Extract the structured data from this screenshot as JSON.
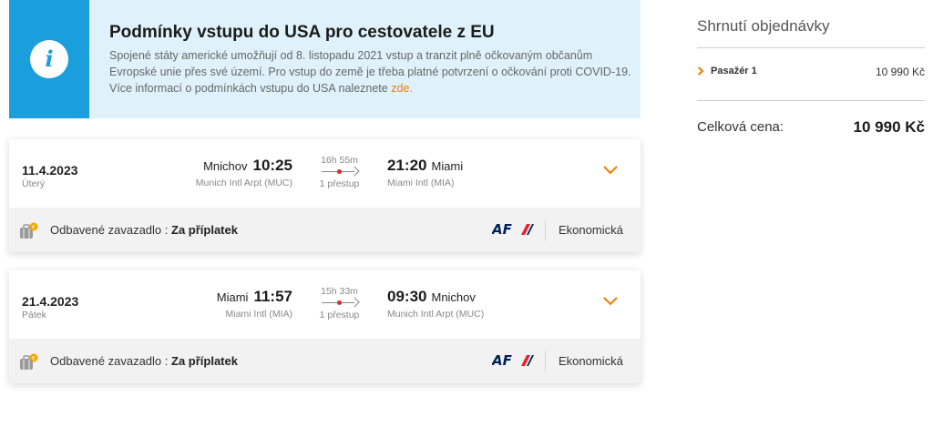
{
  "banner": {
    "title": "Podmínky vstupu do USA pro cestovatele z EU",
    "text_line1": "Spojené státy americké umožňují od 8. listopadu 2021 vstup a tranzit plně očkovaným občanům",
    "text_line2": "Evropské unie přes své území. Pro vstup do země je třeba platné potvrzení o očkování proti COVID-19.",
    "text_line3": "Více informací o podmínkách vstupu do USA naleznete",
    "link": "zde.",
    "icon": "info-icon",
    "accent_color": "#1a9fdc"
  },
  "flights": [
    {
      "date": "11.4.2023",
      "weekday": "Úterý",
      "dep_city": "Mnichov",
      "dep_time": "10:25",
      "dep_airport": "Munich Intl Arpt (MUC)",
      "duration": "16h 55m",
      "stops": "1 přestup",
      "arr_time": "21:20",
      "arr_city": "Miami",
      "arr_airport": "Miami Intl (MIA)",
      "baggage_label": "Odbavené zavazadlo :",
      "baggage_value": "Za příplatek",
      "airline": "AF",
      "cabin": "Ekonomická"
    },
    {
      "date": "21.4.2023",
      "weekday": "Pátek",
      "dep_city": "Miami",
      "dep_time": "11:57",
      "dep_airport": "Miami Intl (MIA)",
      "duration": "15h 33m",
      "stops": "1 přestup",
      "arr_time": "09:30",
      "arr_city": "Mnichov",
      "arr_airport": "Munich Intl Arpt (MUC)",
      "baggage_label": "Odbavené zavazadlo :",
      "baggage_value": "Za příplatek",
      "airline": "AF",
      "cabin": "Ekonomická"
    }
  ],
  "summary": {
    "title": "Shrnutí objednávky",
    "passenger_label": "Pasažér 1",
    "passenger_price": "10 990 Kč",
    "total_label": "Celková cena:",
    "total_value": "10 990 Kč"
  },
  "colors": {
    "brand_orange": "#f07d00",
    "info_blue": "#1a9fdc",
    "banner_bg": "#dff2fb",
    "af_blue": "#002157",
    "af_red": "#e0252b"
  }
}
